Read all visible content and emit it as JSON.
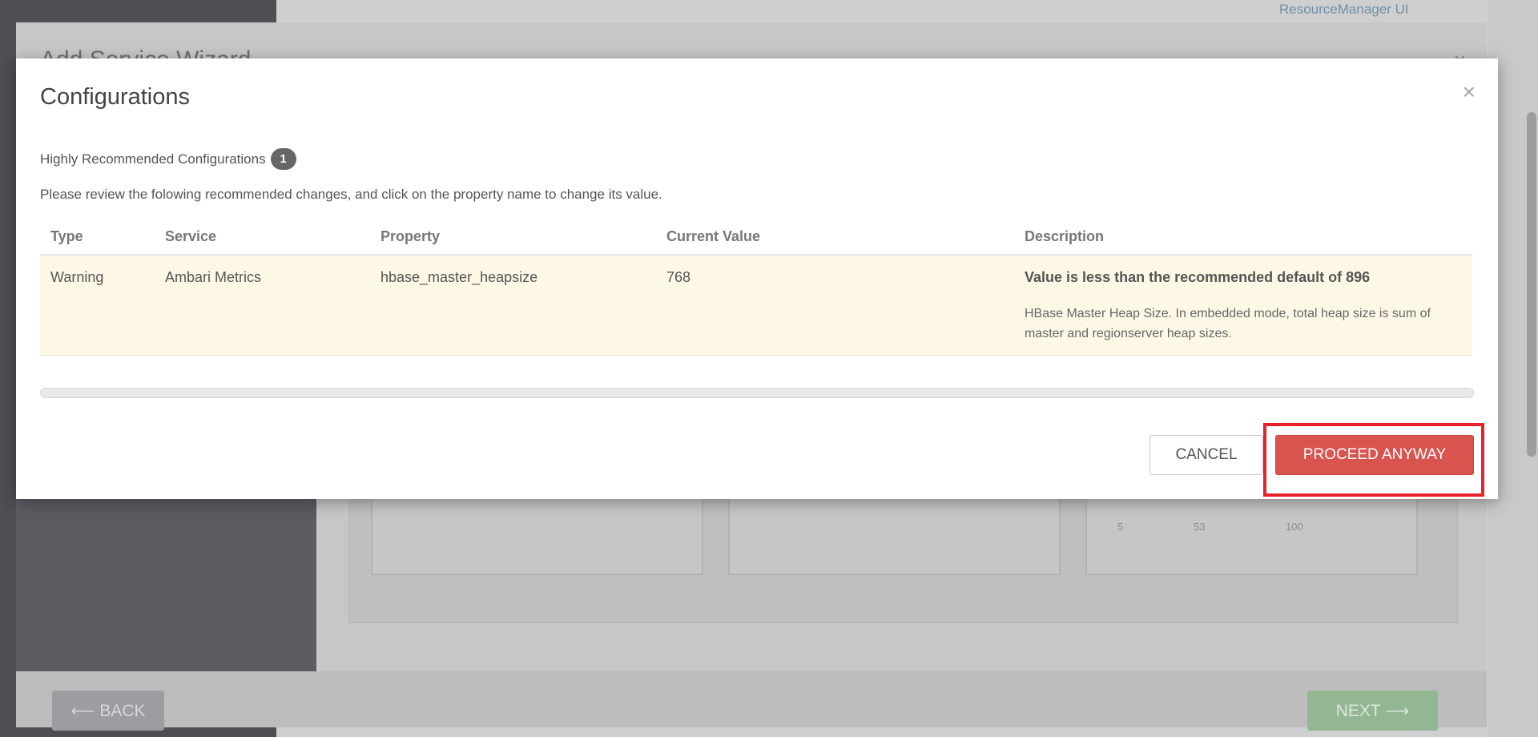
{
  "background": {
    "link_label": "ResourceManager UI",
    "wizard_title": "Add Service Wizard",
    "close_symbol": "×",
    "back_label": "⟵ BACK",
    "next_label": "NEXT ⟶",
    "mini_ticks": [
      "5",
      "53",
      "100"
    ]
  },
  "modal": {
    "title": "Configurations",
    "close_symbol": "×",
    "section_title": "Highly Recommended Configurations",
    "badge_count": "1",
    "instructions": "Please review the folowing recommended changes, and click on the property name to change its value.",
    "table": {
      "headers": [
        "Type",
        "Service",
        "Property",
        "Current Value",
        "Description"
      ],
      "rows": [
        {
          "type": "Warning",
          "service": "Ambari Metrics",
          "property": "hbase_master_heapsize",
          "current_value": "768",
          "description_title": "Value is less than the recommended default of 896",
          "description_text": "HBase Master Heap Size. In embedded mode, total heap size is sum of master and regionserver heap sizes."
        }
      ]
    },
    "cancel_label": "CANCEL",
    "proceed_label": "PROCEED ANYWAY"
  },
  "colors": {
    "warning_row_bg": "#fdf8e6",
    "proceed_button": "#d9534f",
    "highlight_border": "#e8222b",
    "badge_bg": "#666666"
  },
  "icons": {
    "close": "close-icon",
    "back_arrow": "arrow-left-icon",
    "next_arrow": "arrow-right-icon"
  }
}
